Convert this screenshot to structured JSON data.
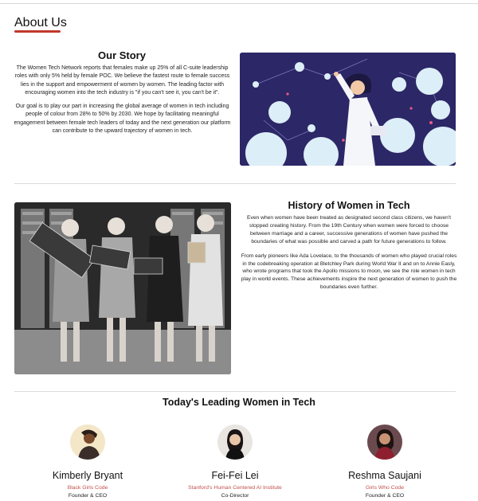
{
  "page": {
    "title": "About Us"
  },
  "story": {
    "heading": "Our Story",
    "paragraphs": [
      "The Women Tech Network reports that females make up 25% of all C-suite leadership roles with only 5% held by female POC. We believe the fastest route to female success lies in the support and empowerment of women by women. The leading factor with encouraging women into the tech industry is \"if you can't see it, you can't be it\".",
      "Our goal is to play our part in increasing the global average of women in tech including people of colour from 28% to 50% by 2030. We hope by facilitating meaningful engagement between female tech leaders of today and the next generation our platform can contribute to the upward trajectory of women in tech."
    ],
    "image_icon": "woman-scientist-illustration"
  },
  "history": {
    "heading": "History of Women in Tech",
    "paragraphs": [
      "Even when women have been treated as designated second class citizens, we haven't stopped creating history. From the 19th Century when women were forced to choose between marriage and a career, successive generations of women have pushed the boundaries of what was possible and carved a path for future generations to follow.",
      "From early pioneers like Ada Lovelace, to the thousands of women who played crucial roles in the codebreaking operation at Bletchley Park during World War II and on to Annie Easly, who wrote programs that took the Apollo missions to moon, we see the role women in tech play in world events. These achievements inspire the next generation of women to push the boundaries even further."
    ],
    "image_icon": "historic-photo-women-computer-engineers"
  },
  "leaders": {
    "heading": "Today's Leading Women in Tech",
    "people": [
      {
        "name": "Kimberly Bryant",
        "org": "Black Girls Code",
        "role": "Founder & CEO"
      },
      {
        "name": "Fei-Fei Lei",
        "org": "Stanford's Human Centered AI Institute",
        "role": "Co-Director"
      },
      {
        "name": "Reshma Saujani",
        "org": "Girls Who Code",
        "role": "Founder & CEO"
      }
    ]
  },
  "colors": {
    "accent": "#c0392b",
    "illustration_bg": "#2c2766",
    "org_text": "#c0504d"
  }
}
